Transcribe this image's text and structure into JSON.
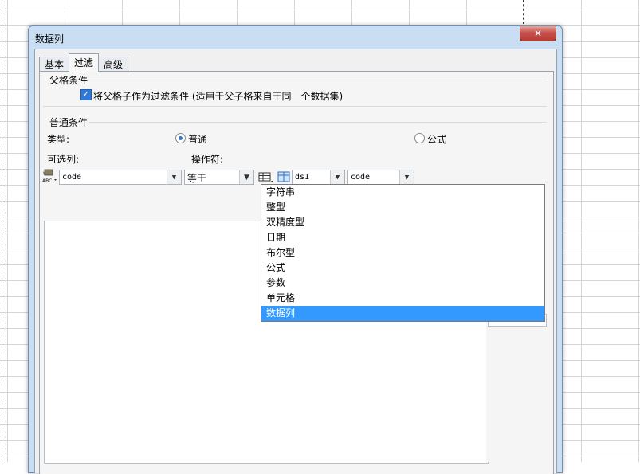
{
  "dialog": {
    "title": "数据列",
    "tabs": [
      {
        "label": "基本",
        "active": false
      },
      {
        "label": "过滤",
        "active": true
      },
      {
        "label": "高级",
        "active": false
      }
    ],
    "parent_section": {
      "title": "父格条件",
      "checkbox_label": "将父格子作为过滤条件 (适用于父子格来自于同一个数据集)",
      "checked": true
    },
    "normal_section": {
      "title": "普通条件",
      "type_label": "类型:",
      "type_options": [
        {
          "label": "普通",
          "selected": true
        },
        {
          "label": "公式",
          "selected": false
        }
      ],
      "column_label": "可选列:",
      "operator_label": "操作符:",
      "column_value": "code",
      "operator_value": "等于",
      "dataset_value": "ds1",
      "field_value": "code"
    },
    "dropdown": {
      "items": [
        "字符串",
        "整型",
        "双精度型",
        "日期",
        "布尔型",
        "公式",
        "参数",
        "单元格",
        "数据列"
      ],
      "selected_index": 8
    },
    "colors": {
      "accent": "#3399ff",
      "frame": "#c9ddf3",
      "close": "#c75050"
    }
  }
}
